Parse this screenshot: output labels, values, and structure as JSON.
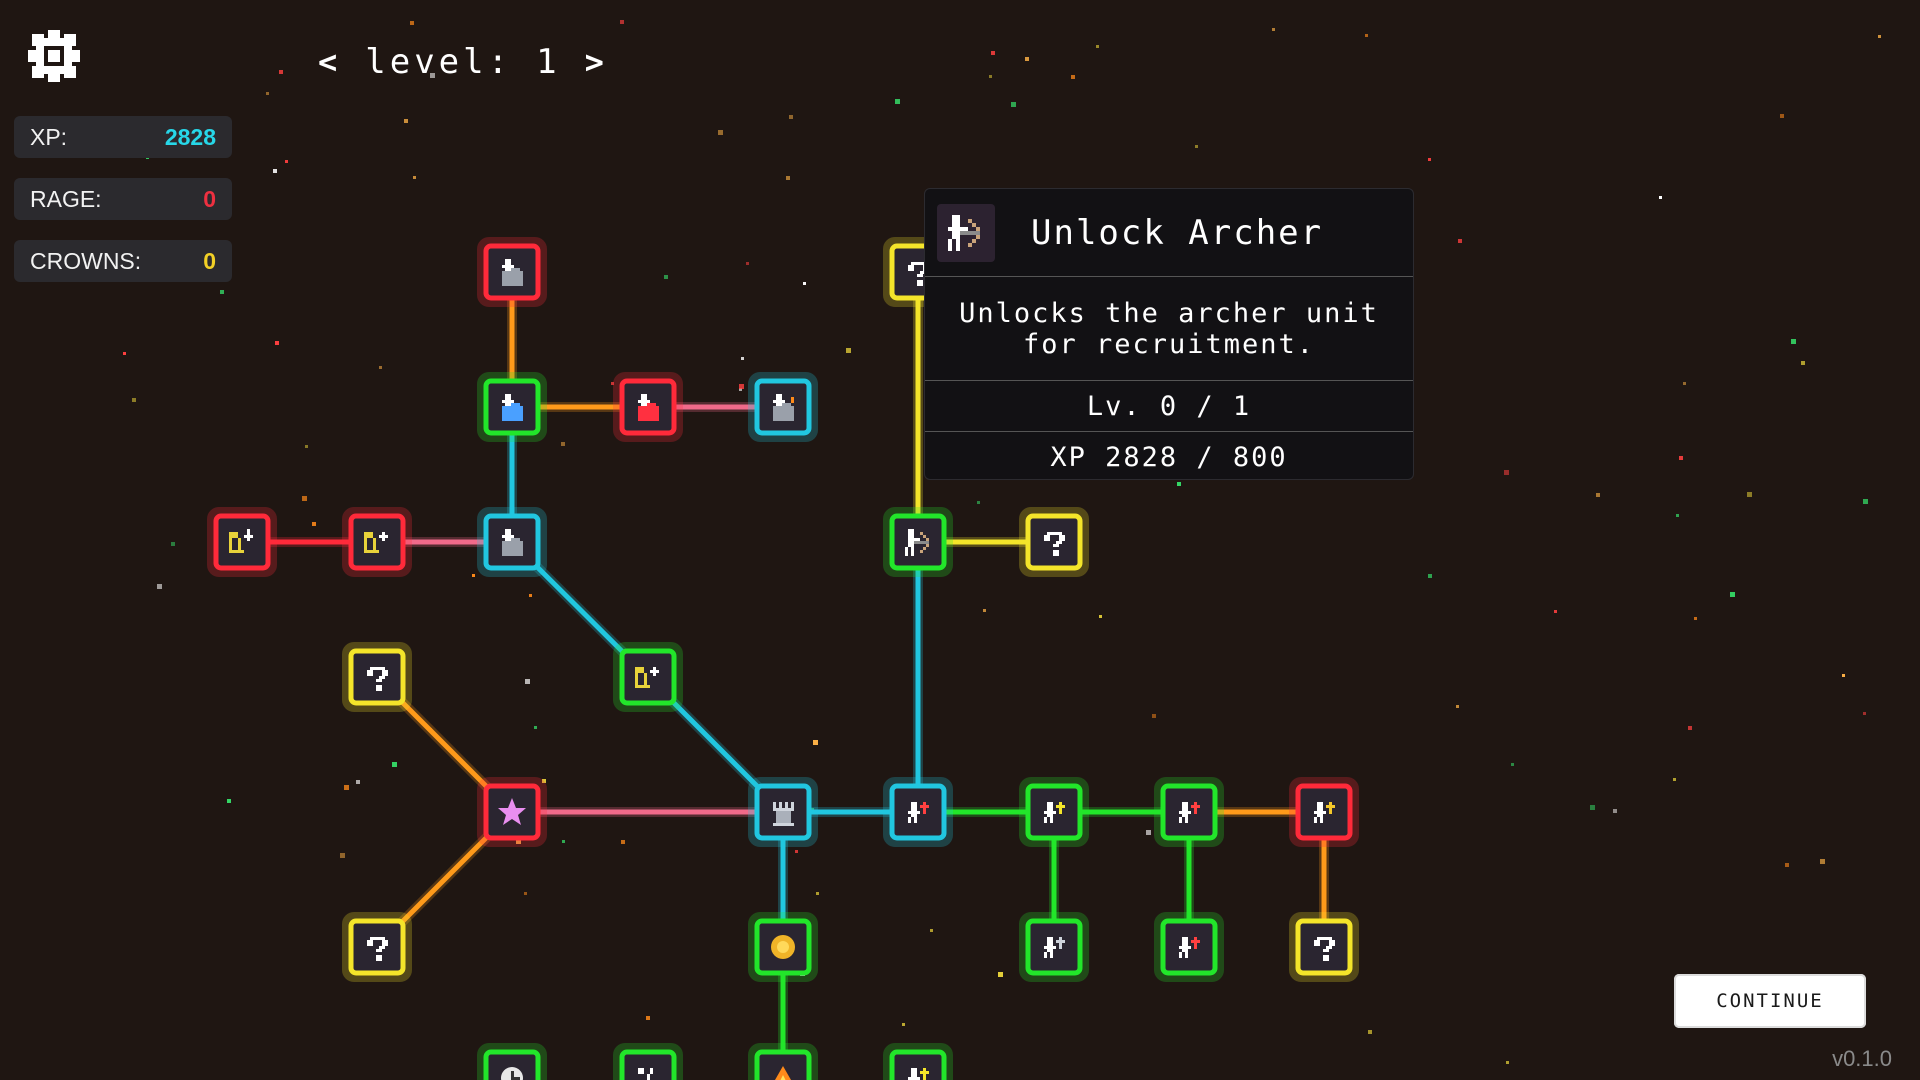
{
  "hud": {
    "level_label": "level:",
    "level_value": "1",
    "stats": [
      {
        "label": "XP:",
        "value": "2828",
        "color": "#27d7e8"
      },
      {
        "label": "RAGE:",
        "value": "0",
        "color": "#ee3040"
      },
      {
        "label": "CROWNS:",
        "value": "0",
        "color": "#f2d026"
      }
    ]
  },
  "tooltip": {
    "icon": "archer-icon",
    "title": "Unlock Archer",
    "description": "Unlocks the archer unit for recruitment.",
    "level_text": "Lv. 0 / 1",
    "xp_text": "XP 2828 / 800"
  },
  "continue_label": "CONTINUE",
  "version": "v0.1.0",
  "colors": {
    "background": "#1f1612",
    "red": "#ff2a3a",
    "green": "#22e62a",
    "cyan": "#21c7e0",
    "yellow": "#f4e52a",
    "orange": "#ff9a1a",
    "pink": "#f06a8a",
    "node_fill": "#2a2530"
  },
  "tree": {
    "nodes": [
      {
        "id": "n-s1",
        "icon": "skull-icon",
        "border": "red"
      },
      {
        "id": "n-s2",
        "icon": "potion-blue-icon",
        "border": "green"
      },
      {
        "id": "n-s3",
        "icon": "potion-red-icon",
        "border": "red"
      },
      {
        "id": "n-s4",
        "icon": "skull-fire-icon",
        "border": "cyan"
      },
      {
        "id": "n-s5",
        "icon": "skull-icon",
        "border": "cyan"
      },
      {
        "id": "n-c1",
        "icon": "castle-upgrade-icon",
        "border": "red"
      },
      {
        "id": "n-c2",
        "icon": "castle-plus-icon",
        "border": "red"
      },
      {
        "id": "n-c3",
        "icon": "castle-plus-icon",
        "border": "green"
      },
      {
        "id": "n-q1",
        "icon": "question-icon",
        "border": "yellow"
      },
      {
        "id": "n-q2",
        "icon": "question-icon",
        "border": "yellow"
      },
      {
        "id": "n-q3",
        "icon": "question-icon",
        "border": "yellow"
      },
      {
        "id": "n-q4",
        "icon": "question-icon",
        "border": "yellow"
      },
      {
        "id": "n-q5",
        "icon": "question-icon",
        "border": "yellow"
      },
      {
        "id": "n-star",
        "icon": "star-icon",
        "border": "red"
      },
      {
        "id": "n-tower",
        "icon": "tower-icon",
        "border": "cyan"
      },
      {
        "id": "n-gold",
        "icon": "gold-coin-icon",
        "border": "green"
      },
      {
        "id": "n-archer",
        "icon": "archer-icon",
        "border": "green"
      },
      {
        "id": "n-u1",
        "icon": "soldier-upgrade-icon",
        "border": "cyan"
      },
      {
        "id": "n-u2",
        "icon": "soldier-plus-icon",
        "border": "green"
      },
      {
        "id": "n-u3",
        "icon": "soldier-upgrade-icon",
        "border": "green"
      },
      {
        "id": "n-u4",
        "icon": "soldier-gold-icon",
        "border": "red"
      },
      {
        "id": "n-u5",
        "icon": "soldier-shield-icon",
        "border": "green"
      },
      {
        "id": "n-u6",
        "icon": "soldier-upgrade-icon",
        "border": "green"
      },
      {
        "id": "n-b1",
        "icon": "clock-icon",
        "border": "green"
      },
      {
        "id": "n-b2",
        "icon": "percent-icon",
        "border": "green"
      },
      {
        "id": "n-b3",
        "icon": "fire-icon",
        "border": "green"
      },
      {
        "id": "n-b4",
        "icon": "soldier-icon",
        "border": "green"
      }
    ],
    "edges": [
      {
        "from": "n-s1",
        "to": "n-s2",
        "color": "orange"
      },
      {
        "from": "n-s2",
        "to": "n-s3",
        "color": "orange"
      },
      {
        "from": "n-s3",
        "to": "n-s4",
        "color": "pink"
      },
      {
        "from": "n-s2",
        "to": "n-s5",
        "color": "cyan"
      },
      {
        "from": "n-c1",
        "to": "n-c2",
        "color": "red"
      },
      {
        "from": "n-c2",
        "to": "n-s5",
        "color": "pink"
      },
      {
        "from": "n-s5",
        "to": "n-c3",
        "color": "cyan"
      },
      {
        "from": "n-c3",
        "to": "n-tower",
        "color": "cyan"
      },
      {
        "from": "n-q1",
        "to": "n-star",
        "color": "orange"
      },
      {
        "from": "n-q2",
        "to": "n-star",
        "color": "orange"
      },
      {
        "from": "n-star",
        "to": "n-tower",
        "color": "pink"
      },
      {
        "from": "n-tower",
        "to": "n-u1",
        "color": "cyan"
      },
      {
        "from": "n-tower",
        "to": "n-gold",
        "color": "cyan"
      },
      {
        "from": "n-gold",
        "to": "n-b3",
        "color": "green"
      },
      {
        "from": "n-u1",
        "to": "n-archer",
        "color": "cyan"
      },
      {
        "from": "n-archer",
        "to": "n-q3",
        "color": "yellow"
      },
      {
        "from": "n-archer",
        "to": "n-q5",
        "color": "yellow"
      },
      {
        "from": "n-u1",
        "to": "n-u2",
        "color": "green"
      },
      {
        "from": "n-u2",
        "to": "n-u3",
        "color": "green"
      },
      {
        "from": "n-u3",
        "to": "n-u4",
        "color": "orange"
      },
      {
        "from": "n-u2",
        "to": "n-u5",
        "color": "green"
      },
      {
        "from": "n-u3",
        "to": "n-u6",
        "color": "green"
      },
      {
        "from": "n-u4",
        "to": "n-q4",
        "color": "orange"
      }
    ]
  }
}
